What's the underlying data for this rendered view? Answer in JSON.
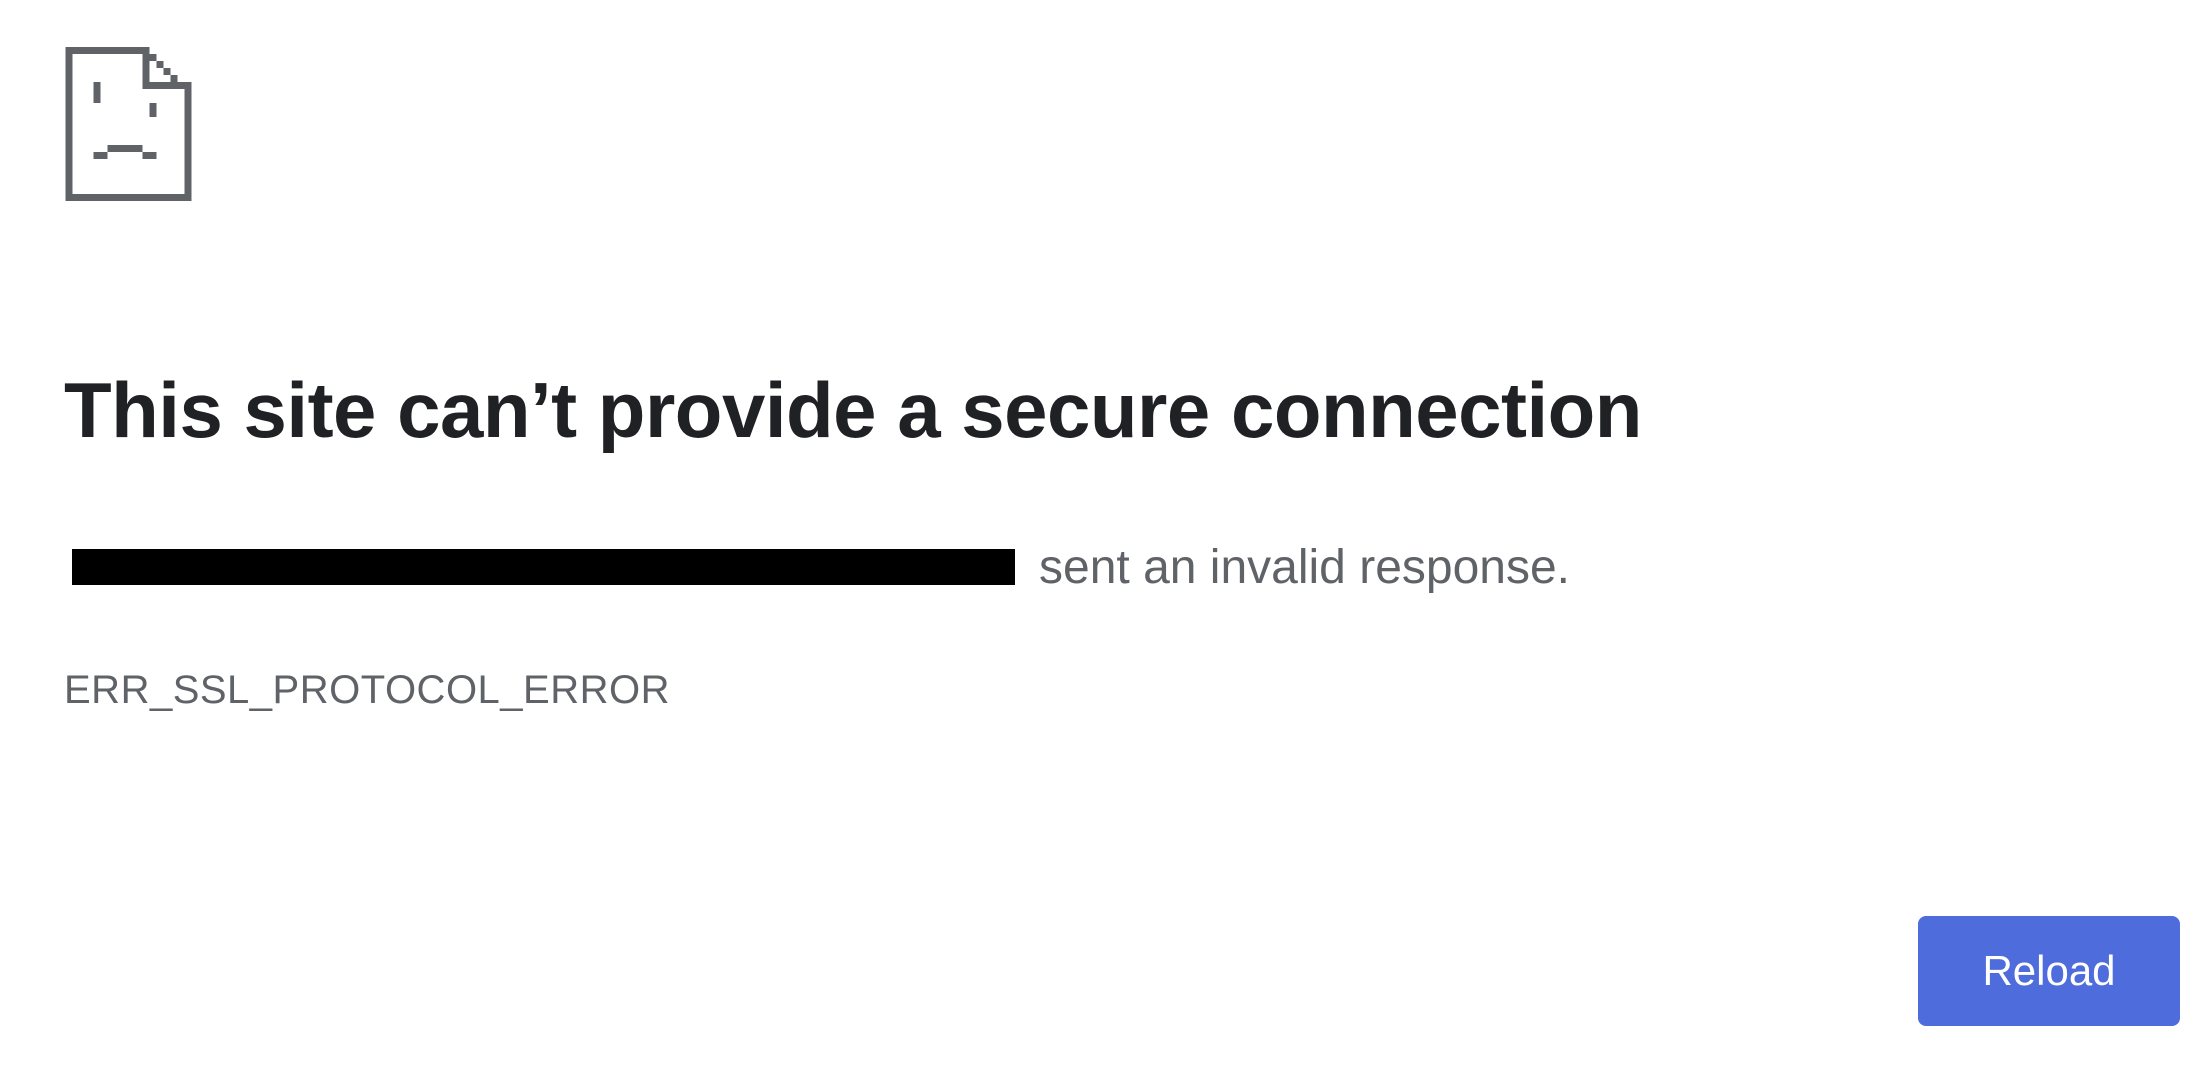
{
  "icon": {
    "name": "sad-page-icon",
    "color": "#5f6368"
  },
  "heading": "This site can’t provide a secure connection",
  "message": {
    "host": "",
    "text": "sent an invalid response."
  },
  "error_code": "ERR_SSL_PROTOCOL_ERROR",
  "reload_button": {
    "label": "Reload",
    "color": "#4f6cdc"
  }
}
